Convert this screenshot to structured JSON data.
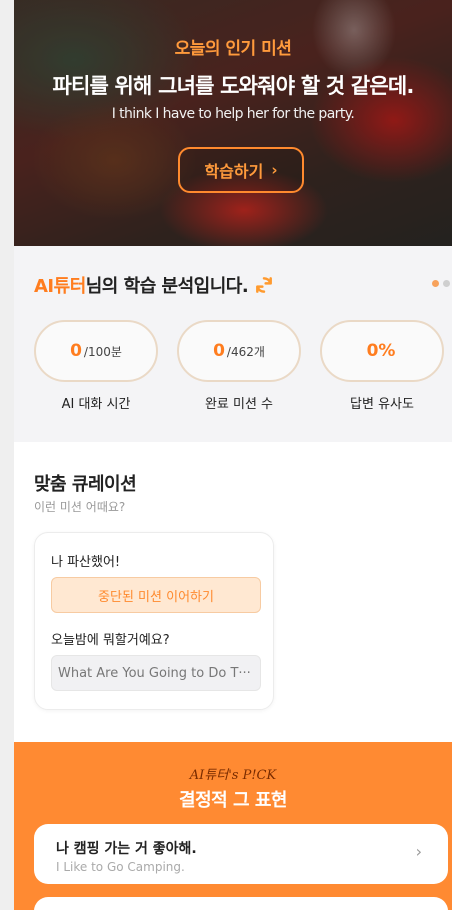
{
  "hero": {
    "badge": "오늘의 인기 미션",
    "title_ko": "파티를 위해 그녀를 도와줘야 할 것 같은데.",
    "title_en": "I think I have to help her for the party.",
    "button_label": "학습하기",
    "button_chevron": "›"
  },
  "analysis": {
    "title_accent": "AI튜터",
    "title_rest": "님의 학습 분석입니다.",
    "stats": [
      {
        "value": "0",
        "unit": "/100분",
        "label": "AI 대화 시간"
      },
      {
        "value": "0",
        "unit": "/462개",
        "label": "완료 미션 수"
      },
      {
        "value": "0%",
        "unit": "",
        "label": "답변 유사도"
      }
    ]
  },
  "curation": {
    "title": "맞춤 큐레이션",
    "subtitle": "이런 미션 어때요?",
    "card": {
      "mission_1": "나 파산했어!",
      "resume_button": "중단된 미션 이어하기",
      "mission_2": "오늘밤에 뭐할거예요?",
      "english_preview": "What Are You Going to Do T···"
    }
  },
  "pick": {
    "brand": "AI튜터's P!CK",
    "title": "결정적 그 표현",
    "items": [
      {
        "ko": "나 캠핑 가는 거 좋아해.",
        "en": "I Like to Go Camping.",
        "chevron": "›"
      }
    ]
  },
  "colors": {
    "accent": "#ff7d1f",
    "pick_background": "#ff8a32",
    "resume_button_bg": "#ffe8d2"
  }
}
